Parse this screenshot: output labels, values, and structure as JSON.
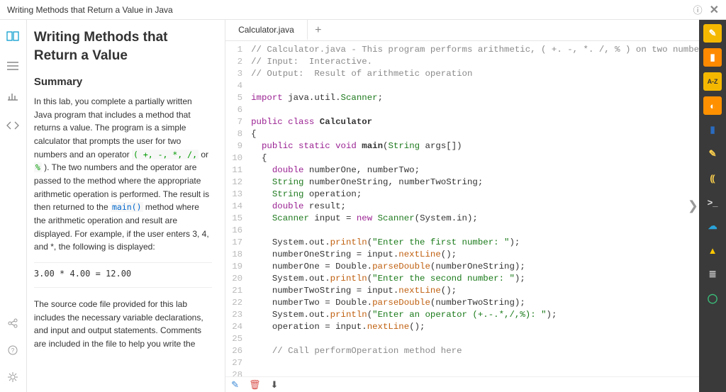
{
  "titlebar": {
    "text": "Writing Methods that Return a Value in Java"
  },
  "instructions": {
    "title": "Writing Methods that Return a Value",
    "summary_heading": "Summary",
    "para1a": "In this lab, you complete a partially written Java program that includes a method that returns a value. The program is a simple calculator that prompts the user for two numbers and an operator ",
    "ops": "( +, -, *, /,",
    "para1b": " or ",
    "opmod": "%",
    "para1c": " ). The two numbers and the operator are passed to the method where the appropriate arithmetic operation is performed. The result is then returned to the ",
    "main_fn": "main()",
    "para1d": " method where the arithmetic operation and result are displayed. For example, if the user enters 3, 4, and *, the following is displayed:",
    "formula": "3.00 * 4.00 = 12.00",
    "para2": "The source code file provided for this lab includes the necessary variable declarations, and input and output statements. Comments are included in the file to help you write the"
  },
  "editor": {
    "tab1": "Calculator.java",
    "lines": [
      {
        "n": 1,
        "segs": [
          {
            "c": "c-cm",
            "t": "// Calculator.java - This program performs arithmetic, ( +. -, *. /, % ) on two numbe"
          }
        ]
      },
      {
        "n": 2,
        "segs": [
          {
            "c": "c-cm",
            "t": "// Input:  Interactive."
          }
        ]
      },
      {
        "n": 3,
        "segs": [
          {
            "c": "c-cm",
            "t": "// Output:  Result of arithmetic operation"
          }
        ]
      },
      {
        "n": 4,
        "segs": [
          {
            "c": "",
            "t": ""
          }
        ]
      },
      {
        "n": 5,
        "segs": [
          {
            "c": "c-kw",
            "t": "import"
          },
          {
            "c": "",
            "t": " java.util."
          },
          {
            "c": "c-ty",
            "t": "Scanner"
          },
          {
            "c": "",
            "t": ";"
          }
        ]
      },
      {
        "n": 6,
        "segs": [
          {
            "c": "",
            "t": ""
          }
        ]
      },
      {
        "n": 7,
        "segs": [
          {
            "c": "c-kw",
            "t": "public class"
          },
          {
            "c": "",
            "t": " "
          },
          {
            "c": "c-id",
            "t": "Calculator"
          }
        ]
      },
      {
        "n": 8,
        "segs": [
          {
            "c": "",
            "t": "{"
          }
        ]
      },
      {
        "n": 9,
        "segs": [
          {
            "c": "",
            "t": "  "
          },
          {
            "c": "c-kw",
            "t": "public static"
          },
          {
            "c": "",
            "t": " "
          },
          {
            "c": "c-kw",
            "t": "void"
          },
          {
            "c": "",
            "t": " "
          },
          {
            "c": "c-id",
            "t": "main"
          },
          {
            "c": "",
            "t": "("
          },
          {
            "c": "c-ty",
            "t": "String"
          },
          {
            "c": "",
            "t": " args[])"
          }
        ]
      },
      {
        "n": 10,
        "segs": [
          {
            "c": "",
            "t": "  {"
          }
        ]
      },
      {
        "n": 11,
        "segs": [
          {
            "c": "",
            "t": "    "
          },
          {
            "c": "c-kw",
            "t": "double"
          },
          {
            "c": "",
            "t": " numberOne, numberTwo;"
          }
        ]
      },
      {
        "n": 12,
        "segs": [
          {
            "c": "",
            "t": "    "
          },
          {
            "c": "c-ty",
            "t": "String"
          },
          {
            "c": "",
            "t": " numberOneString, numberTwoString;"
          }
        ]
      },
      {
        "n": 13,
        "segs": [
          {
            "c": "",
            "t": "    "
          },
          {
            "c": "c-ty",
            "t": "String"
          },
          {
            "c": "",
            "t": " operation;"
          }
        ]
      },
      {
        "n": 14,
        "segs": [
          {
            "c": "",
            "t": "    "
          },
          {
            "c": "c-kw",
            "t": "double"
          },
          {
            "c": "",
            "t": " result;"
          }
        ]
      },
      {
        "n": 15,
        "segs": [
          {
            "c": "",
            "t": "    "
          },
          {
            "c": "c-ty",
            "t": "Scanner"
          },
          {
            "c": "",
            "t": " input = "
          },
          {
            "c": "c-kw",
            "t": "new"
          },
          {
            "c": "",
            "t": " "
          },
          {
            "c": "c-ty",
            "t": "Scanner"
          },
          {
            "c": "",
            "t": "(System.in);"
          }
        ]
      },
      {
        "n": 16,
        "segs": [
          {
            "c": "",
            "t": ""
          }
        ]
      },
      {
        "n": 17,
        "segs": [
          {
            "c": "",
            "t": "    System.out."
          },
          {
            "c": "c-fn",
            "t": "println"
          },
          {
            "c": "",
            "t": "("
          },
          {
            "c": "c-str",
            "t": "\"Enter the first number: \""
          },
          {
            "c": "",
            "t": ");"
          }
        ]
      },
      {
        "n": 18,
        "segs": [
          {
            "c": "",
            "t": "    numberOneString = input."
          },
          {
            "c": "c-fn",
            "t": "nextLine"
          },
          {
            "c": "",
            "t": "();"
          }
        ]
      },
      {
        "n": 19,
        "segs": [
          {
            "c": "",
            "t": "    numberOne = Double."
          },
          {
            "c": "c-fn",
            "t": "parseDouble"
          },
          {
            "c": "",
            "t": "(numberOneString);"
          }
        ]
      },
      {
        "n": 20,
        "segs": [
          {
            "c": "",
            "t": "    System.out."
          },
          {
            "c": "c-fn",
            "t": "println"
          },
          {
            "c": "",
            "t": "("
          },
          {
            "c": "c-str",
            "t": "\"Enter the second number: \""
          },
          {
            "c": "",
            "t": ");"
          }
        ]
      },
      {
        "n": 21,
        "segs": [
          {
            "c": "",
            "t": "    numberTwoString = input."
          },
          {
            "c": "c-fn",
            "t": "nextLine"
          },
          {
            "c": "",
            "t": "();"
          }
        ]
      },
      {
        "n": 22,
        "segs": [
          {
            "c": "",
            "t": "    numberTwo = Double."
          },
          {
            "c": "c-fn",
            "t": "parseDouble"
          },
          {
            "c": "",
            "t": "(numberTwoString);"
          }
        ]
      },
      {
        "n": 23,
        "segs": [
          {
            "c": "",
            "t": "    System.out."
          },
          {
            "c": "c-fn",
            "t": "println"
          },
          {
            "c": "",
            "t": "("
          },
          {
            "c": "c-str",
            "t": "\"Enter an operator (+.-.*,/,%): \""
          },
          {
            "c": "",
            "t": ");"
          }
        ]
      },
      {
        "n": 24,
        "segs": [
          {
            "c": "",
            "t": "    operation = input."
          },
          {
            "c": "c-fn",
            "t": "nextLine"
          },
          {
            "c": "",
            "t": "();"
          }
        ]
      },
      {
        "n": 25,
        "segs": [
          {
            "c": "",
            "t": ""
          }
        ]
      },
      {
        "n": 26,
        "segs": [
          {
            "c": "",
            "t": "    "
          },
          {
            "c": "c-cm",
            "t": "// Call performOperation method here"
          }
        ]
      },
      {
        "n": 27,
        "segs": [
          {
            "c": "",
            "t": ""
          }
        ]
      },
      {
        "n": 28,
        "segs": [
          {
            "c": "",
            "t": ""
          }
        ]
      }
    ]
  },
  "right_rail": {
    "items": [
      {
        "bg": "#f5b800",
        "fg": "#fff",
        "glyph": "✎"
      },
      {
        "bg": "#ff8a00",
        "fg": "#fff",
        "glyph": "▮"
      },
      {
        "bg": "#f5b800",
        "fg": "#333",
        "glyph": "A-Z"
      },
      {
        "bg": "#ff9100",
        "fg": "#fff",
        "glyph": "◐"
      },
      {
        "bg": "transparent",
        "fg": "#2a6bbf",
        "glyph": "▮"
      },
      {
        "bg": "transparent",
        "fg": "#ffd24d",
        "glyph": "✎"
      },
      {
        "bg": "transparent",
        "fg": "#ffd24d",
        "glyph": "⸨"
      },
      {
        "bg": "transparent",
        "fg": "#ddd",
        "glyph": ">_"
      },
      {
        "bg": "transparent",
        "fg": "#2aa3d9",
        "glyph": "☁"
      },
      {
        "bg": "transparent",
        "fg": "#ffc800",
        "glyph": "▲"
      },
      {
        "bg": "transparent",
        "fg": "#ccc",
        "glyph": "≣"
      },
      {
        "bg": "transparent",
        "fg": "#3bbf7a",
        "glyph": "◯"
      }
    ]
  }
}
